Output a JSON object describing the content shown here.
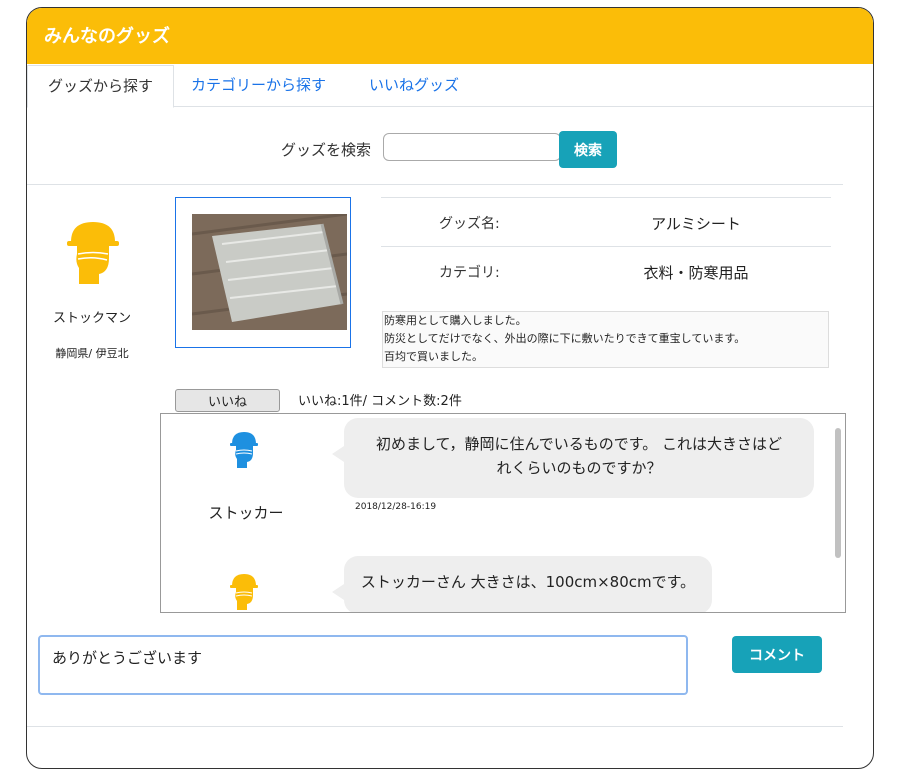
{
  "header": {
    "title": "みんなのグッズ",
    "color": "#fbbd08"
  },
  "tabs": [
    {
      "label": "グッズから探す",
      "active": true
    },
    {
      "label": "カテゴリーから探す",
      "active": false
    },
    {
      "label": "いいねグッズ",
      "active": false
    }
  ],
  "search": {
    "label": "グッズを検索",
    "value": "",
    "placeholder": "",
    "button_label": "検索"
  },
  "owner": {
    "name": "ストックマン",
    "location": "静岡県/ 伊豆北",
    "avatar_icon": "helmet-person-icon",
    "avatar_color": "#fbbd08"
  },
  "goods": {
    "name_key": "グッズ名:",
    "name_value": "アルミシート",
    "category_key": "カテゴリ:",
    "category_value": "衣料・防寒用品",
    "description": [
      "防寒用として購入しました。",
      "防災としてだけでなく、外出の際に下に敷いたりできて重宝しています。",
      "百均で買いました。"
    ]
  },
  "like": {
    "button_label": "いいね",
    "stats": "いいね:1件/ コメント数:2件"
  },
  "comments": [
    {
      "user": "ストッカー",
      "avatar_color": "#1e90e0",
      "text_line1": "初めまして，静岡に住んでいるものです。 これは大きさはど",
      "text_line2": "れくらいのものですか？",
      "time": "2018/12/28-16:19"
    },
    {
      "user": "",
      "avatar_color": "#fbbd08",
      "text_line1": "ストッカーさん 大きさは、100cm×80cmです。",
      "text_line2": "",
      "time": ""
    }
  ],
  "comment_form": {
    "value": "ありがとうございます",
    "button_label": "コメント"
  }
}
